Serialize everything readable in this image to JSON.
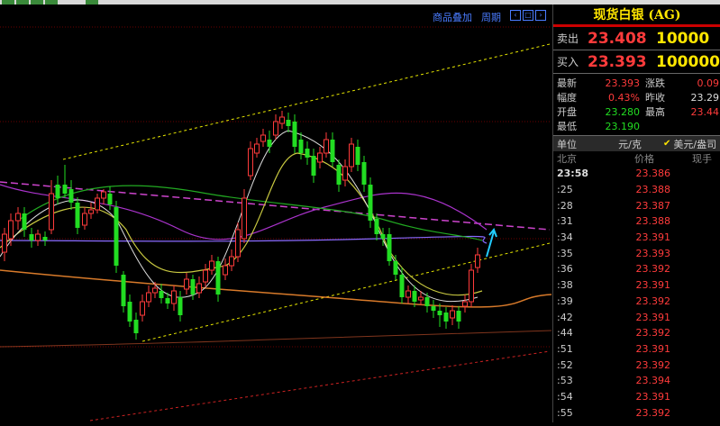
{
  "chart_toolbar": {
    "overlay_label": "商品叠加",
    "period_label": "周期"
  },
  "quote": {
    "title": "现货白银 (AG)",
    "sell": {
      "label": "卖出",
      "price": "23.408",
      "volume": "10000"
    },
    "buy": {
      "label": "买入",
      "price": "23.393",
      "volume": "100000"
    },
    "stats": [
      {
        "k": "最新",
        "v": "23.393",
        "k2": "涨跌",
        "v2": "0.09"
      },
      {
        "k": "幅度",
        "v": "0.43%",
        "k2": "昨收",
        "v2": "23.29"
      },
      {
        "k": "开盘",
        "v": "23.280",
        "k2": "最高",
        "v2": "23.44"
      },
      {
        "k": "最低",
        "v": "23.190",
        "k2": "",
        "v2": ""
      }
    ],
    "unit": {
      "label": "单位",
      "value": "元/克",
      "alt": "美元/盎司"
    },
    "tick_header": {
      "time": "北京",
      "price": "价格",
      "vol": "现手"
    },
    "ticks": [
      {
        "t": "23:58",
        "p": "23.386"
      },
      {
        "t": ":25",
        "p": "23.388"
      },
      {
        "t": ":28",
        "p": "23.387"
      },
      {
        "t": ":31",
        "p": "23.388"
      },
      {
        "t": ":34",
        "p": "23.391"
      },
      {
        "t": ":35",
        "p": "23.393"
      },
      {
        "t": ":36",
        "p": "23.392"
      },
      {
        "t": ":38",
        "p": "23.391"
      },
      {
        "t": ":39",
        "p": "23.392"
      },
      {
        "t": ":42",
        "p": "23.391"
      },
      {
        "t": ":44",
        "p": "23.392"
      },
      {
        "t": ":51",
        "p": "23.391"
      },
      {
        "t": ":52",
        "p": "23.392"
      },
      {
        "t": ":53",
        "p": "23.394"
      },
      {
        "t": ":54",
        "p": "23.391"
      },
      {
        "t": ":55",
        "p": "23.392"
      }
    ]
  },
  "colors": {
    "up": "#ff3b3b",
    "down": "#22dd22",
    "accent": "#ffe600",
    "link": "#4a7cff"
  }
}
